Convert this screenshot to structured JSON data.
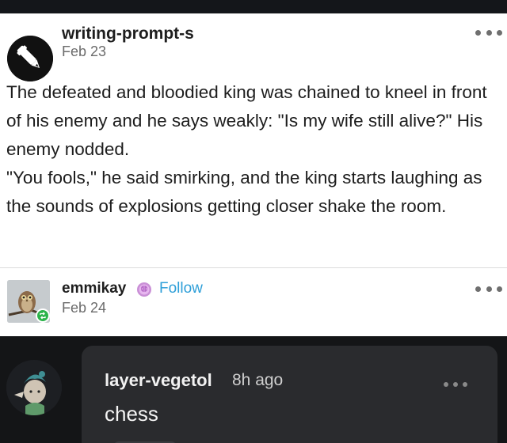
{
  "original_post": {
    "author": "writing-prompt-s",
    "date": "Feb 23",
    "body": [
      "The defeated and bloodied king was chained to kneel in front of his enemy and he says weakly: \"Is my wife still alive?\" His enemy nodded.",
      "\"You fools,\" he said smirking, and the king starts laughing as the sounds of explosions getting closer shake the room."
    ]
  },
  "reblog": {
    "author": "emmikay",
    "follow_label": "Follow",
    "date": "Feb 24"
  },
  "reply": {
    "author": "layer-vegetol",
    "time": "8h ago",
    "text": "chess"
  },
  "colors": {
    "follow_link": "#2e9fd8",
    "reblog_badge": "#2bb34a",
    "dark_background": "#141517",
    "reply_bubble": "#2a2b2e"
  },
  "icons": {
    "post_avatar": "pen-icon",
    "reblog_indicator": "reblog-icon",
    "community_badge": "brain-badge-icon",
    "menu": "more-options-icon"
  }
}
